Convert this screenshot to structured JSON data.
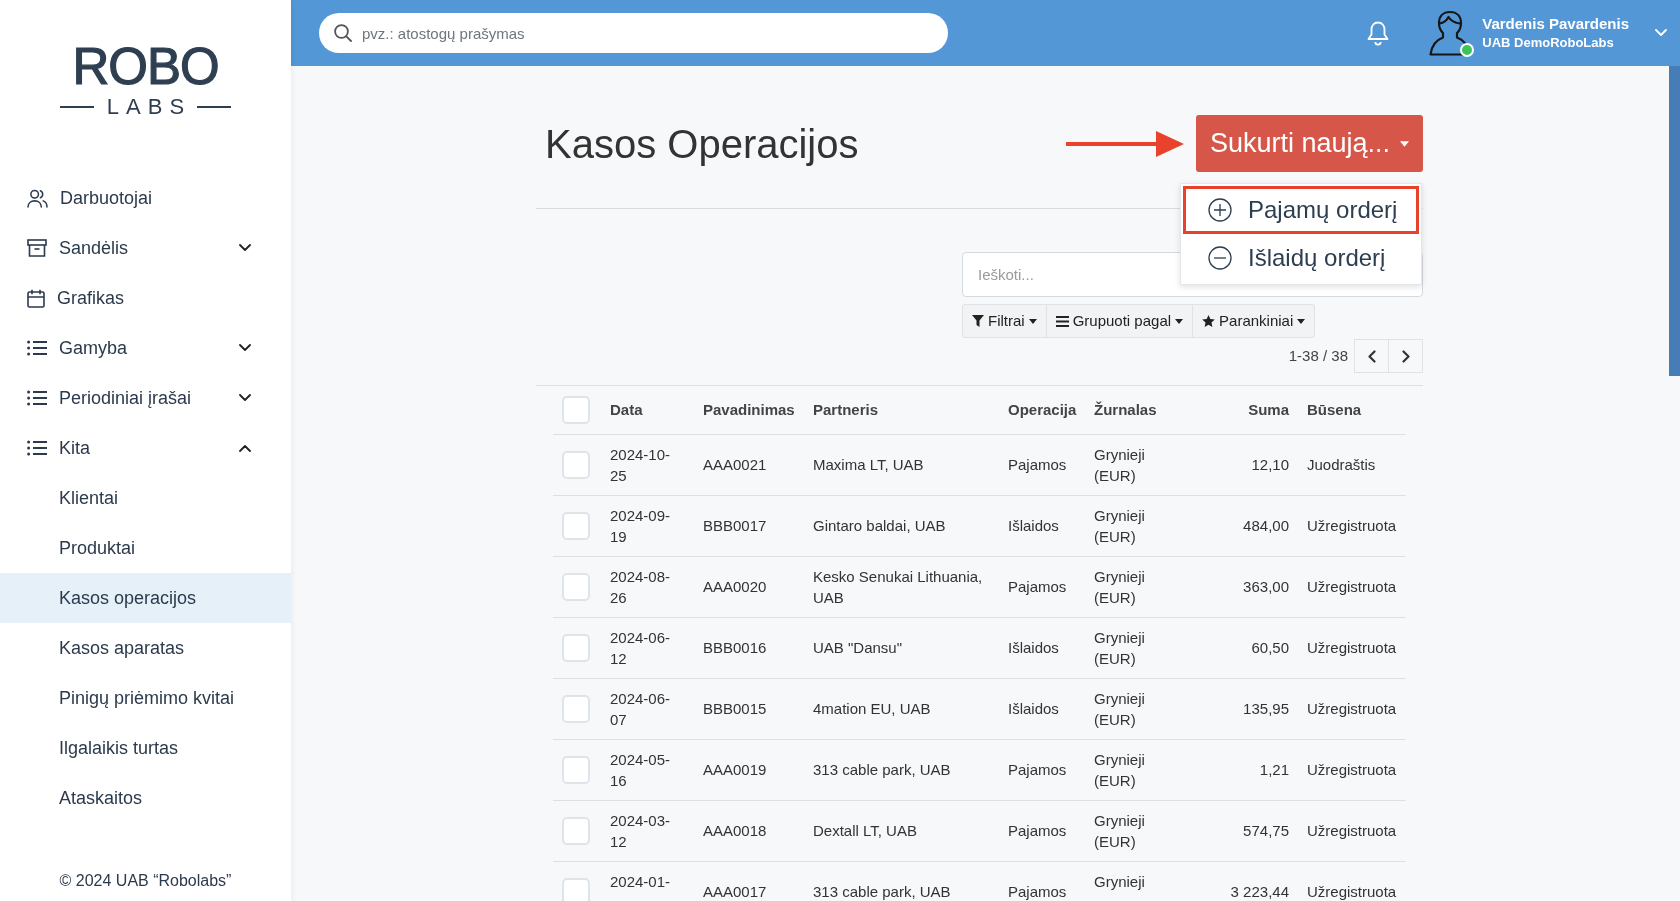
{
  "sidebar": {
    "logo": {
      "top": "ROBO",
      "bottom": "LABS"
    },
    "items": [
      {
        "label": "Darbuotojai",
        "selected": false
      },
      {
        "label": "Sandėlis",
        "selected": false,
        "expanded": false
      },
      {
        "label": "Grafikas",
        "selected": false
      },
      {
        "label": "Gamyba",
        "selected": false,
        "expanded": false
      },
      {
        "label": "Periodiniai įrašai",
        "selected": false,
        "expanded": false
      },
      {
        "label": "Kita",
        "selected": false,
        "expanded": true,
        "children": [
          {
            "label": "Klientai",
            "selected": false
          },
          {
            "label": "Produktai",
            "selected": false
          },
          {
            "label": "Kasos operacijos",
            "selected": true
          },
          {
            "label": "Kasos aparatas",
            "selected": false
          },
          {
            "label": "Pinigų priėmimo kvitai",
            "selected": false
          },
          {
            "label": "Ilgalaikis turtas",
            "selected": false
          },
          {
            "label": "Ataskaitos",
            "selected": false
          }
        ]
      }
    ],
    "footer": "© 2024 UAB “Robolabs”"
  },
  "top_bar": {
    "search": {
      "placeholder": "pvz.: atostogų prašymas"
    },
    "user": {
      "name": "Vardenis Pavardenis",
      "company": "UAB DemoRoboLabs",
      "online": true
    }
  },
  "page": {
    "title": "Kasos Operacijos",
    "create_button": {
      "label": "Sukurti naują...",
      "annotated": true,
      "menu_open": true
    },
    "create_menu": [
      {
        "label": "Pajamų orderį",
        "highlighted": true
      },
      {
        "label": "Išlaidų orderį",
        "highlighted": false
      }
    ],
    "search": {
      "placeholder": "Ieškoti..."
    },
    "filter_buttons": [
      "Filtrai",
      "Grupuoti pagal",
      "Parankiniai"
    ],
    "pager": "1-38 / 38"
  },
  "table": {
    "select_all_checked": false,
    "columns": [
      "Data",
      "Pavadinimas",
      "Partneris",
      "Operacija",
      "Žurnalas",
      "Suma",
      "Būsena"
    ],
    "rows": [
      {
        "checked": false,
        "cells": [
          "2024-10-25",
          "AAA0021",
          "Maxima LT, UAB",
          "Pajamos",
          "Grynieji (EUR)",
          "12,10",
          "Juodraštis"
        ]
      },
      {
        "checked": false,
        "cells": [
          "2024-09-19",
          "BBB0017",
          "Gintaro baldai, UAB",
          "Išlaidos",
          "Grynieji (EUR)",
          "484,00",
          "Užregistruota"
        ]
      },
      {
        "checked": false,
        "cells": [
          "2024-08-26",
          "AAA0020",
          "Kesko Senukai Lithuania, UAB",
          "Pajamos",
          "Grynieji (EUR)",
          "363,00",
          "Užregistruota"
        ]
      },
      {
        "checked": false,
        "cells": [
          "2024-06-12",
          "BBB0016",
          "UAB \"Dansu\"",
          "Išlaidos",
          "Grynieji (EUR)",
          "60,50",
          "Užregistruota"
        ]
      },
      {
        "checked": false,
        "cells": [
          "2024-06-07",
          "BBB0015",
          "4mation EU, UAB",
          "Išlaidos",
          "Grynieji (EUR)",
          "135,95",
          "Užregistruota"
        ]
      },
      {
        "checked": false,
        "cells": [
          "2024-05-16",
          "AAA0019",
          "313 cable park, UAB",
          "Pajamos",
          "Grynieji (EUR)",
          "1,21",
          "Užregistruota"
        ]
      },
      {
        "checked": false,
        "cells": [
          "2024-03-12",
          "AAA0018",
          "Dextall LT, UAB",
          "Pajamos",
          "Grynieji (EUR)",
          "574,75",
          "Užregistruota"
        ]
      },
      {
        "checked": false,
        "cells": [
          "2024-01-",
          "AAA0017",
          "313 cable park, UAB",
          "Pajamos",
          "Grynieji",
          "3 223,44",
          "Užregistruota"
        ]
      }
    ]
  }
}
